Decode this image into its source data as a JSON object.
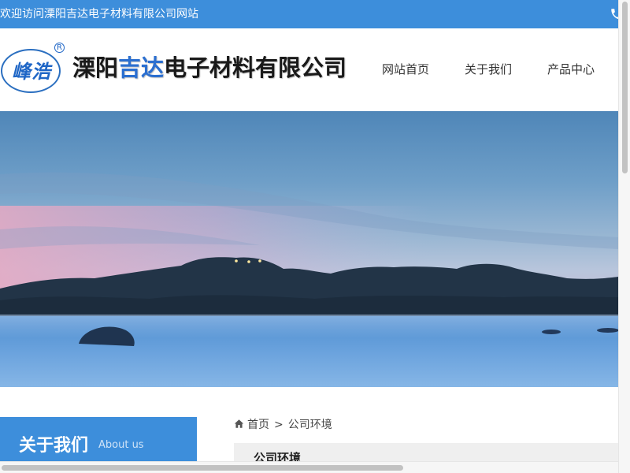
{
  "topbar": {
    "welcome_text": "欢迎访问溧阳吉达电子材料有限公司网站",
    "phone_icon": "phone-icon"
  },
  "header": {
    "logo_text": "峰浩",
    "logo_registered": "R",
    "company_name_part1": "溧阳",
    "company_name_part2": "吉达",
    "company_name_part3": "电子材料有限公司",
    "nav": [
      {
        "label": "网站首页"
      },
      {
        "label": "关于我们"
      },
      {
        "label": "产品中心"
      }
    ]
  },
  "sidebar": {
    "title": "关于我们",
    "title_en": "About us"
  },
  "breadcrumb": {
    "home_label": "首页",
    "separator": ">",
    "current": "公司环境"
  },
  "section": {
    "heading": "公司环境"
  },
  "colors": {
    "primary": "#3d8edb",
    "brand_blue": "#2b6fd0"
  }
}
